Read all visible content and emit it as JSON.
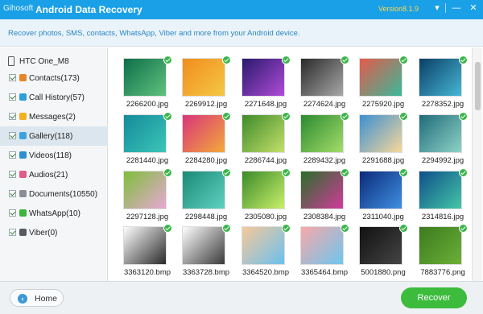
{
  "window": {
    "logo_text": "Gihosoft",
    "title": "Android Data Recovery",
    "version": "Version8.1.9",
    "menu_icon": "chevron-down-icon",
    "minimize_icon": "minimize-icon",
    "close_icon": "close-icon",
    "colors": {
      "titlebar": "#1aa0e6",
      "version": "#ffd84a"
    }
  },
  "banner": {
    "text": "Recover photos, SMS, contacts, WhatsApp, Viber and more from your Android device."
  },
  "sidebar": {
    "device": {
      "label": "HTC One_M8",
      "icon": "phone-icon"
    },
    "items": [
      {
        "label": "Contacts(173)",
        "icon": "contacts-icon",
        "color": "#e5862a",
        "checked": true
      },
      {
        "label": "Call History(57)",
        "icon": "call-history-icon",
        "color": "#2d9fd9",
        "checked": true
      },
      {
        "label": "Messages(2)",
        "icon": "messages-icon",
        "color": "#f2b01e",
        "checked": true
      },
      {
        "label": "Gallery(118)",
        "icon": "gallery-icon",
        "color": "#3aa3e0",
        "checked": true,
        "selected": true
      },
      {
        "label": "Videos(118)",
        "icon": "videos-icon",
        "color": "#2b8fd1",
        "checked": true
      },
      {
        "label": "Audios(21)",
        "icon": "audios-icon",
        "color": "#e05a8a",
        "checked": true
      },
      {
        "label": "Documents(10550)",
        "icon": "documents-icon",
        "color": "#8a8f95",
        "checked": true
      },
      {
        "label": "WhatsApp(10)",
        "icon": "whatsapp-icon",
        "color": "#3cb43c",
        "checked": true
      },
      {
        "label": "Viber(0)",
        "icon": "viber-icon",
        "color": "#555b61",
        "checked": true
      }
    ]
  },
  "gallery": {
    "items": [
      {
        "name": "2266200.jpg",
        "colors": [
          "#0f6e4a",
          "#5fc27e"
        ],
        "checked": true
      },
      {
        "name": "2269912.jpg",
        "colors": [
          "#f28c1e",
          "#f4c845"
        ],
        "checked": true
      },
      {
        "name": "2271648.jpg",
        "colors": [
          "#2a1a6e",
          "#b04bd6"
        ],
        "checked": true
      },
      {
        "name": "2274624.jpg",
        "colors": [
          "#2a2a2a",
          "#a8a8a8"
        ],
        "checked": true
      },
      {
        "name": "2275920.jpg",
        "colors": [
          "#e45a4a",
          "#3bb89a"
        ],
        "checked": true
      },
      {
        "name": "2278352.jpg",
        "colors": [
          "#0b3f66",
          "#46b7d6"
        ],
        "checked": true
      },
      {
        "name": "2281440.jpg",
        "colors": [
          "#148a9a",
          "#3cc6b8"
        ],
        "checked": true
      },
      {
        "name": "2284280.jpg",
        "colors": [
          "#d8357a",
          "#f4a93a"
        ],
        "checked": true
      },
      {
        "name": "2286744.jpg",
        "colors": [
          "#3e8a2a",
          "#c4e06a"
        ],
        "checked": true
      },
      {
        "name": "2289432.jpg",
        "colors": [
          "#2b8a30",
          "#a4dd6a"
        ],
        "checked": true
      },
      {
        "name": "2291688.jpg",
        "colors": [
          "#3d8fd1",
          "#f6d89a"
        ],
        "checked": true
      },
      {
        "name": "2294992.jpg",
        "colors": [
          "#1f6b7a",
          "#8ed2c6"
        ],
        "checked": true
      },
      {
        "name": "2297128.jpg",
        "colors": [
          "#7fbf3a",
          "#e7a8d4"
        ],
        "checked": true
      },
      {
        "name": "2298448.jpg",
        "colors": [
          "#1a8a76",
          "#5fd1c0"
        ],
        "checked": true
      },
      {
        "name": "2305080.jpg",
        "colors": [
          "#3b8a2a",
          "#c9f06a"
        ],
        "checked": true
      },
      {
        "name": "2308384.jpg",
        "colors": [
          "#2a6e2a",
          "#d23a9a"
        ],
        "checked": true
      },
      {
        "name": "2311040.jpg",
        "colors": [
          "#0c2a7a",
          "#3f8fe0"
        ],
        "checked": true
      },
      {
        "name": "2314816.jpg",
        "colors": [
          "#0e4f8a",
          "#44c6a6"
        ],
        "checked": true
      },
      {
        "name": "3363120.bmp",
        "colors": [
          "#ffffff",
          "#2a2a2a"
        ],
        "checked": true
      },
      {
        "name": "3363728.bmp",
        "colors": [
          "#ffffff",
          "#3a3a3a"
        ],
        "checked": true
      },
      {
        "name": "3364520.bmp",
        "colors": [
          "#f7c89a",
          "#6ac1ee"
        ],
        "checked": true
      },
      {
        "name": "3365464.bmp",
        "colors": [
          "#f7a8a8",
          "#6ec6ee"
        ],
        "checked": true
      },
      {
        "name": "5001880.png",
        "colors": [
          "#111111",
          "#444444"
        ],
        "checked": true
      },
      {
        "name": "7883776.png",
        "colors": [
          "#3d7a1e",
          "#6bb038"
        ],
        "checked": true
      }
    ]
  },
  "footer": {
    "home_label": "Home",
    "home_icon": "chevron-left-icon",
    "recover_label": "Recover",
    "colors": {
      "recover": "#3cbb3c"
    }
  }
}
